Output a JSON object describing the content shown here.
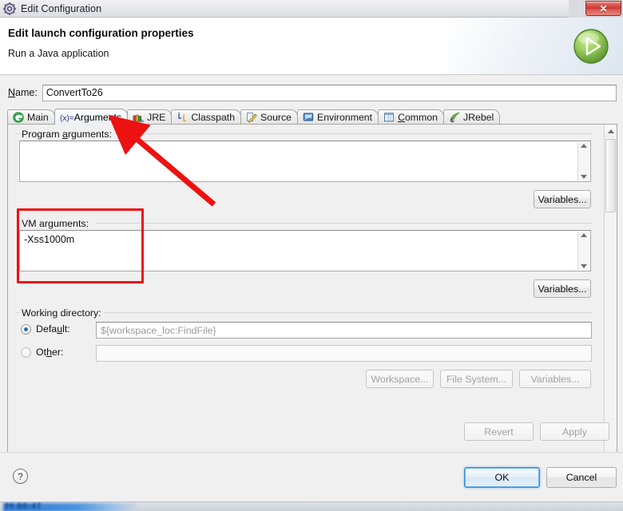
{
  "window": {
    "title": "Edit Configuration",
    "title_icon": "gear-icon",
    "close_label": "✕"
  },
  "header": {
    "title": "Edit launch configuration properties",
    "subtitle": "Run a Java application",
    "icon": "run-play-icon"
  },
  "name_field": {
    "label": "Name:",
    "label_mnemonic": "N",
    "value": "ConvertTo26"
  },
  "tabs": [
    {
      "label": "Main",
      "icon": "java-main-class-icon",
      "active": false,
      "mnemonic": ""
    },
    {
      "label": "Arguments",
      "icon": "variable-xeq-icon",
      "active": true,
      "mnemonic": ""
    },
    {
      "label": "JRE",
      "icon": "jre-books-icon",
      "active": false,
      "mnemonic": ""
    },
    {
      "label": "Classpath",
      "icon": "classpath-arrows-icon",
      "active": false,
      "mnemonic": ""
    },
    {
      "label": "Source",
      "icon": "source-pencil-icon",
      "active": false,
      "mnemonic": ""
    },
    {
      "label": "Environment",
      "icon": "environment-icon",
      "active": false,
      "mnemonic": ""
    },
    {
      "label": "Common",
      "icon": "common-sheet-icon",
      "active": false,
      "mnemonic": "C"
    },
    {
      "label": "JRebel",
      "icon": "jrebel-icon",
      "active": false,
      "mnemonic": ""
    }
  ],
  "arguments_tab": {
    "program_arguments": {
      "label": "Program arguments:",
      "label_mnemonic": "a",
      "value": "",
      "variables_button": "Variables..."
    },
    "vm_arguments": {
      "label": "VM arguments:",
      "label_mnemonic": "g",
      "value": "-Xss1000m",
      "variables_button": "Variables..."
    },
    "working_directory": {
      "label": "Working directory:",
      "default_radio": {
        "label": "Default:",
        "label_mnemonic": "u",
        "checked": true,
        "value": "${workspace_loc:FindFile}"
      },
      "other_radio": {
        "label": "Other:",
        "label_mnemonic": "h",
        "checked": false,
        "value": ""
      },
      "buttons": [
        {
          "label": "Workspace...",
          "enabled": false
        },
        {
          "label": "File System...",
          "enabled": false
        },
        {
          "label": "Variables...",
          "enabled": false
        }
      ]
    }
  },
  "action_buttons": {
    "revert": {
      "label": "Revert",
      "enabled": false
    },
    "apply": {
      "label": "Apply",
      "enabled": false
    }
  },
  "footer": {
    "help": "?",
    "ok": "OK",
    "cancel": "Cancel"
  },
  "annotations": {
    "highlight_box_target": "vm-arguments-group",
    "arrow_target": "tab-arguments",
    "color": "#ee1111"
  },
  "colors": {
    "accent_blue": "#3c8fd6",
    "annotation_red": "#ee1111",
    "run_green": "#7ab648",
    "close_red": "#c9352e"
  }
}
